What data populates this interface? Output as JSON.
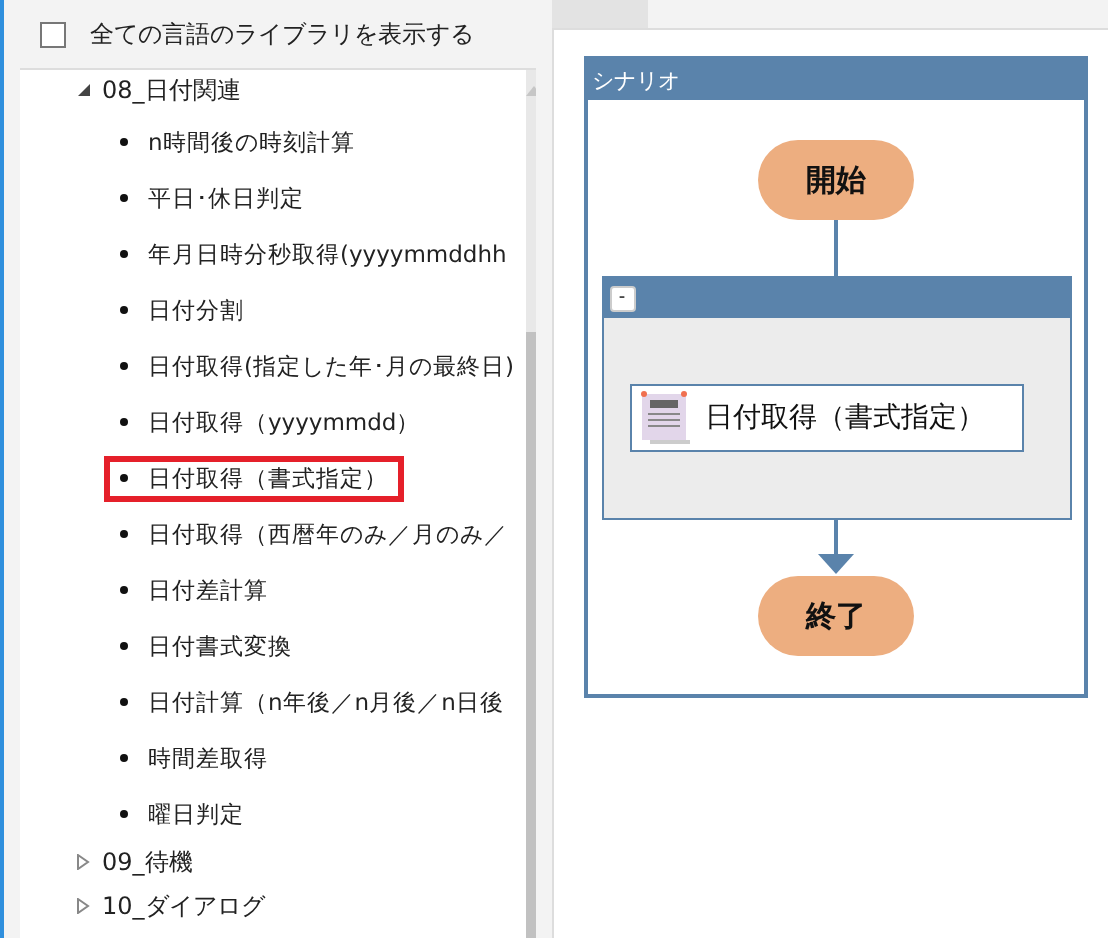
{
  "library_toggle": {
    "label": "全ての言語のライブラリを表示する",
    "checked": false
  },
  "tree": [
    {
      "label": "08_日付関連",
      "expanded": true,
      "children": [
        {
          "label": "n時間後の時刻計算",
          "selected": false
        },
        {
          "label": "平日･休日判定",
          "selected": false
        },
        {
          "label": "年月日時分秒取得(yyyymmddhh",
          "selected": false
        },
        {
          "label": "日付分割",
          "selected": false
        },
        {
          "label": "日付取得(指定した年･月の最終日)",
          "selected": false
        },
        {
          "label": "日付取得（yyyymmdd）",
          "selected": false
        },
        {
          "label": "日付取得（書式指定）",
          "selected": true
        },
        {
          "label": "日付取得（西暦年のみ／月のみ／",
          "selected": false
        },
        {
          "label": "日付差計算",
          "selected": false
        },
        {
          "label": "日付書式変換",
          "selected": false
        },
        {
          "label": "日付計算（n年後／n月後／n日後",
          "selected": false
        },
        {
          "label": "時間差取得",
          "selected": false
        },
        {
          "label": "曜日判定",
          "selected": false
        }
      ]
    },
    {
      "label": "09_待機",
      "expanded": false
    },
    {
      "label": "10_ダイアログ",
      "expanded": false
    }
  ],
  "scenario": {
    "title": "シナリオ",
    "start": "開始",
    "group": {
      "collapse_button": "-",
      "action": {
        "label": "日付取得（書式指定）"
      }
    },
    "end": "終了"
  }
}
